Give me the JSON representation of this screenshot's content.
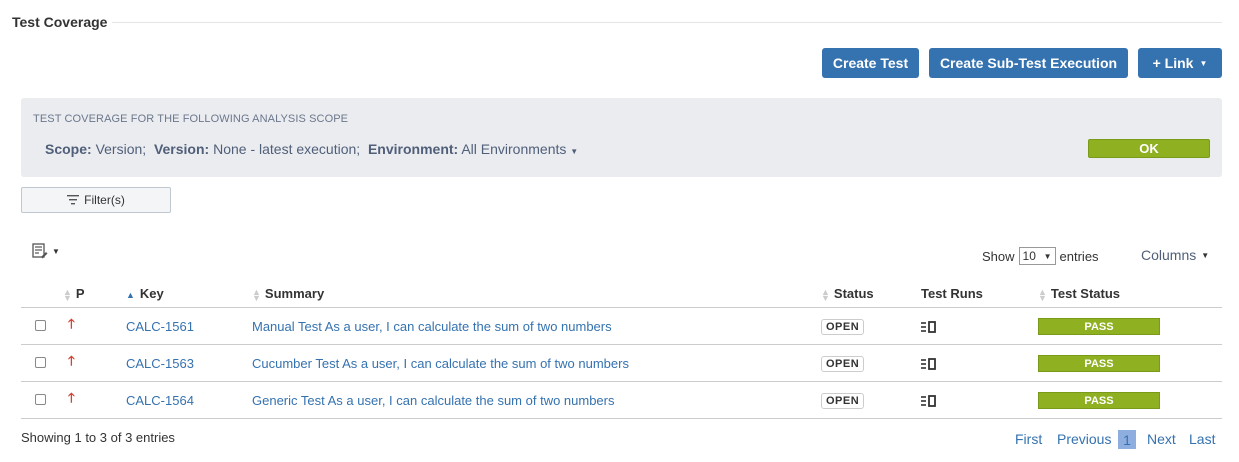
{
  "section": {
    "title": "Test Coverage"
  },
  "toolbar": {
    "create_test": "Create Test",
    "create_sub_test": "Create Sub-Test Execution",
    "link": "+ Link"
  },
  "scope": {
    "heading": "TEST COVERAGE FOR THE FOLLOWING ANALYSIS SCOPE",
    "scope_label": "Scope:",
    "scope_value": "Version;",
    "version_label": "Version:",
    "version_value": "None - latest execution;",
    "environment_label": "Environment:",
    "environment_value": "All Environments",
    "ok": "OK"
  },
  "filter": {
    "label": "Filter(s)"
  },
  "show": {
    "prefix": "Show",
    "value": "10",
    "suffix": "entries"
  },
  "columns_label": "Columns",
  "table": {
    "headers": {
      "p": "P",
      "key": "Key",
      "summary": "Summary",
      "status": "Status",
      "test_runs": "Test Runs",
      "test_status": "Test Status"
    },
    "rows": [
      {
        "key": "CALC-1561",
        "summary": "Manual Test As a user, I can calculate the sum of two numbers",
        "status": "OPEN",
        "test_status": "PASS"
      },
      {
        "key": "CALC-1563",
        "summary": "Cucumber Test As a user, I can calculate the sum of two numbers",
        "status": "OPEN",
        "test_status": "PASS"
      },
      {
        "key": "CALC-1564",
        "summary": "Generic Test As a user, I can calculate the sum of two numbers",
        "status": "OPEN",
        "test_status": "PASS"
      }
    ]
  },
  "footer": {
    "showing": "Showing 1 to 3 of 3 entries",
    "first": "First",
    "previous": "Previous",
    "current_page": "1",
    "next": "Next",
    "last": "Last"
  },
  "colors": {
    "primary": "#3572b0",
    "pass": "#8eb021",
    "priority": "#d04437"
  },
  "icons": {
    "priority": "arrow-up-icon",
    "runs": "test-runs-icon",
    "filter": "filter-icon",
    "doc": "document-edit-icon"
  }
}
